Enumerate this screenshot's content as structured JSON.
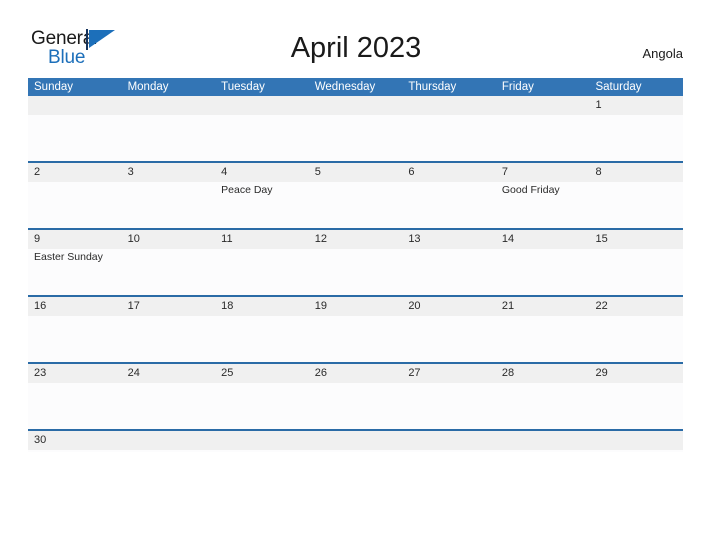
{
  "brand": {
    "word_one": "General",
    "word_two": "Blue",
    "mark_name": "blue-triangle-logo-mark",
    "accent_color": "#1c6fba"
  },
  "header": {
    "title": "April 2023",
    "region": "Angola"
  },
  "colors": {
    "header_blue": "#3375b5",
    "row_divider_blue": "#2a6ba6",
    "date_band_gray": "#f0f0f0",
    "cell_background": "#fcfcfd",
    "text": "#2a2a2a"
  },
  "calendar": {
    "weekdays": [
      "Sunday",
      "Monday",
      "Tuesday",
      "Wednesday",
      "Thursday",
      "Friday",
      "Saturday"
    ],
    "weeks": [
      {
        "days": [
          {
            "number": "",
            "event": ""
          },
          {
            "number": "",
            "event": ""
          },
          {
            "number": "",
            "event": ""
          },
          {
            "number": "",
            "event": ""
          },
          {
            "number": "",
            "event": ""
          },
          {
            "number": "",
            "event": ""
          },
          {
            "number": "1",
            "event": ""
          }
        ]
      },
      {
        "days": [
          {
            "number": "2",
            "event": ""
          },
          {
            "number": "3",
            "event": ""
          },
          {
            "number": "4",
            "event": "Peace Day"
          },
          {
            "number": "5",
            "event": ""
          },
          {
            "number": "6",
            "event": ""
          },
          {
            "number": "7",
            "event": "Good Friday"
          },
          {
            "number": "8",
            "event": ""
          }
        ]
      },
      {
        "days": [
          {
            "number": "9",
            "event": "Easter Sunday"
          },
          {
            "number": "10",
            "event": ""
          },
          {
            "number": "11",
            "event": ""
          },
          {
            "number": "12",
            "event": ""
          },
          {
            "number": "13",
            "event": ""
          },
          {
            "number": "14",
            "event": ""
          },
          {
            "number": "15",
            "event": ""
          }
        ]
      },
      {
        "days": [
          {
            "number": "16",
            "event": ""
          },
          {
            "number": "17",
            "event": ""
          },
          {
            "number": "18",
            "event": ""
          },
          {
            "number": "19",
            "event": ""
          },
          {
            "number": "20",
            "event": ""
          },
          {
            "number": "21",
            "event": ""
          },
          {
            "number": "22",
            "event": ""
          }
        ]
      },
      {
        "days": [
          {
            "number": "23",
            "event": ""
          },
          {
            "number": "24",
            "event": ""
          },
          {
            "number": "25",
            "event": ""
          },
          {
            "number": "26",
            "event": ""
          },
          {
            "number": "27",
            "event": ""
          },
          {
            "number": "28",
            "event": ""
          },
          {
            "number": "29",
            "event": ""
          }
        ]
      },
      {
        "days": [
          {
            "number": "30",
            "event": ""
          },
          {
            "number": "",
            "event": ""
          },
          {
            "number": "",
            "event": ""
          },
          {
            "number": "",
            "event": ""
          },
          {
            "number": "",
            "event": ""
          },
          {
            "number": "",
            "event": ""
          },
          {
            "number": "",
            "event": ""
          }
        ]
      }
    ]
  }
}
